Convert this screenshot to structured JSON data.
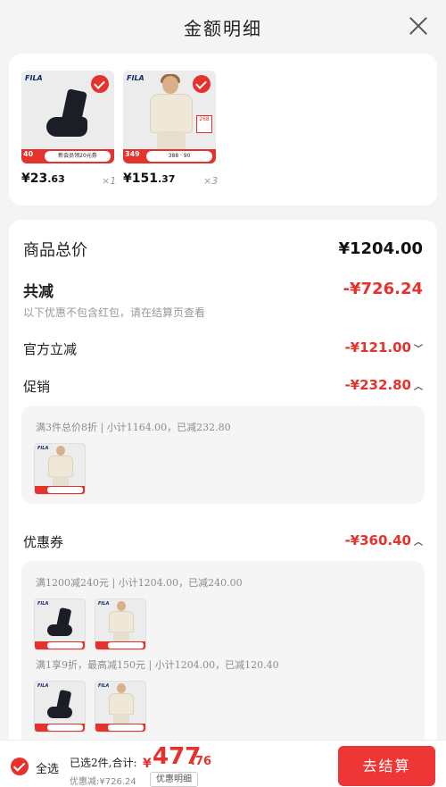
{
  "header": {
    "title": "金额明细"
  },
  "products": [
    {
      "brand": "FILA",
      "price_main": "¥23",
      "price_cents": ".63",
      "qty": "×1",
      "promo_num": "40",
      "promo_tag": "新会员领20元券"
    },
    {
      "brand": "FILA",
      "price_main": "¥151",
      "price_cents": ".37",
      "qty": "×3",
      "promo_num": "349",
      "promo_tag": "388  ·  90",
      "mini_tag": "268"
    }
  ],
  "summary": {
    "total_label": "商品总价",
    "total_value": "¥1204.00",
    "reduce_label": "共减",
    "reduce_value": "-¥726.24",
    "reduce_note": "以下优惠不包含红包，请在结算页查看",
    "official_label": "官方立减",
    "official_value": "-¥121.00",
    "promo_label": "促销",
    "promo_value": "-¥232.80",
    "promo_detail": "满3件总价8折 | 小计1164.00，已减232.80",
    "coupon_label": "优惠券",
    "coupon_value": "-¥360.40",
    "coupon_detail_1": "满1200减240元 | 小计1204.00，已减240.00",
    "coupon_detail_2": "满1享9折，最高减150元 | 小计1204.00，已减120.40"
  },
  "footer": {
    "select_all": "全选",
    "summary": "已选2件,合计:",
    "currency": "¥",
    "total": "477",
    "cents": ".76",
    "discount": "优惠减:¥726.24",
    "detail_button": "优惠明细",
    "checkout_button": "去结算"
  },
  "colors": {
    "accent": "#e5322d",
    "checkout_bg": "#ef3636"
  },
  "icons": [
    "close-icon",
    "check-circle-icon",
    "chevron-down-icon",
    "chevron-up-icon"
  ]
}
